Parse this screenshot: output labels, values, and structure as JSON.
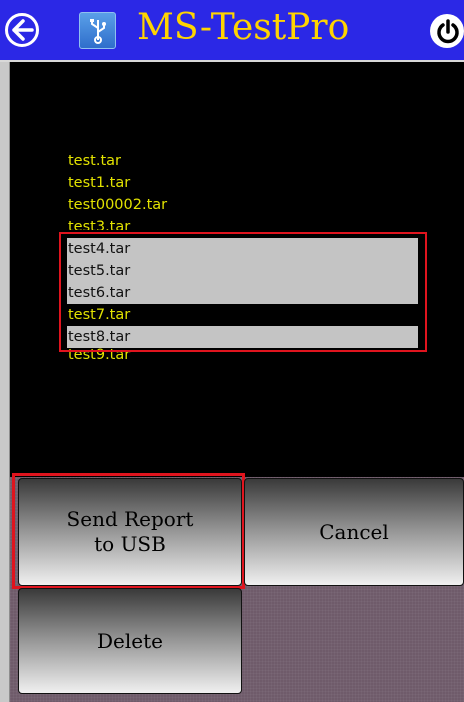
{
  "header": {
    "title": "MS-TestPro",
    "back_icon": "back-arrow-icon",
    "usb_icon": "usb-icon",
    "power_icon": "power-icon",
    "title_color": "#ffd400",
    "bar_color": "#2b28e6"
  },
  "files": [
    {
      "name": "test.tar",
      "selected": false
    },
    {
      "name": "test1.tar",
      "selected": false
    },
    {
      "name": "test00002.tar",
      "selected": false
    },
    {
      "name": "test3.tar",
      "selected": false
    },
    {
      "name": "test4.tar",
      "selected": true
    },
    {
      "name": "test5.tar",
      "selected": true
    },
    {
      "name": "test6.tar",
      "selected": true
    },
    {
      "name": "test7.tar",
      "selected": false
    },
    {
      "name": "test8.tar",
      "selected": true
    },
    {
      "name": "test9.tar",
      "selected": false
    }
  ],
  "buttons": {
    "send_report_line1": "Send Report",
    "send_report_line2": "to USB",
    "cancel": "Cancel",
    "delete": "Delete"
  },
  "colors": {
    "file_text": "#e2e200",
    "selected_bg": "#c4c4c4",
    "highlight": "#e0141e"
  }
}
